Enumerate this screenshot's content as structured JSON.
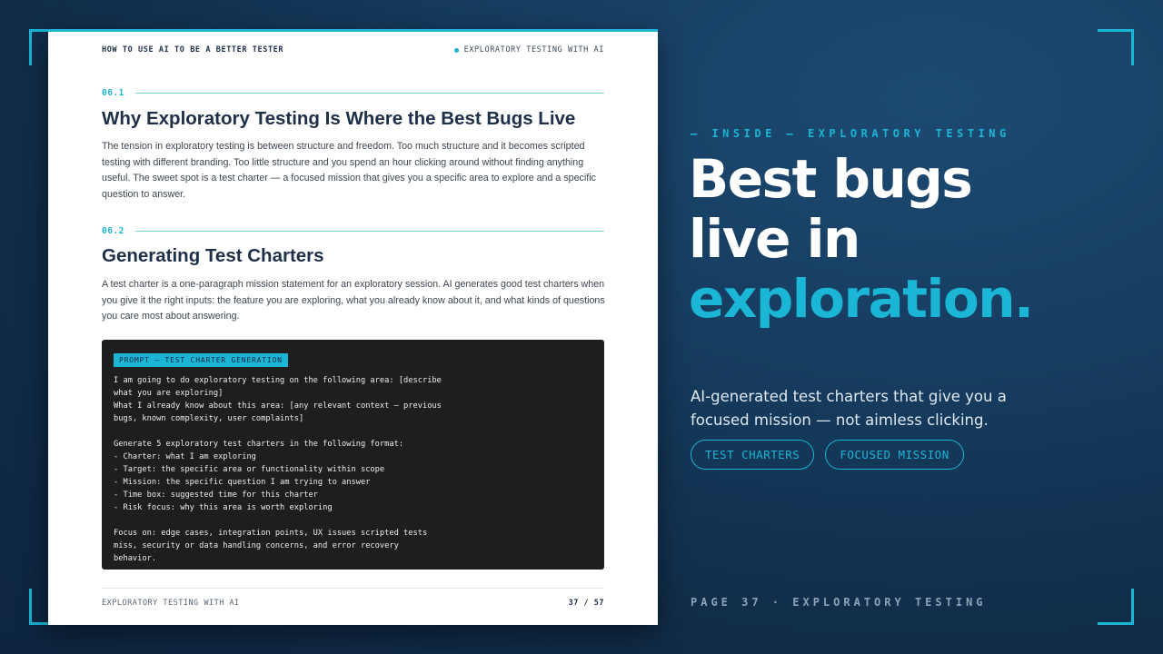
{
  "document": {
    "book_title": "HOW TO USE AI TO BE A BETTER TESTER",
    "chapter_label": "EXPLORATORY TESTING WITH AI",
    "sections": [
      {
        "number": "06.1",
        "title": "Why Exploratory Testing Is Where the Best Bugs Live",
        "body": "The tension in exploratory testing is between structure and freedom. Too much structure and it becomes scripted testing with different branding. Too little structure and you spend an hour clicking around without finding anything useful. The sweet spot is a test charter — a focused mission that gives you a specific area to explore and a specific question to answer."
      },
      {
        "number": "06.2",
        "title": "Generating Test Charters",
        "body": "A test charter is a one-paragraph mission statement for an exploratory session. AI generates good test charters when you give it the right inputs: the feature you are exploring, what you already know about it, and what kinds of questions you care most about answering."
      }
    ],
    "prompt_box": {
      "label": "PROMPT — TEST CHARTER GENERATION",
      "text": "I am going to do exploratory testing on the following area: [describe\nwhat you are exploring]\nWhat I already know about this area: [any relevant context — previous\nbugs, known complexity, user complaints]\n\nGenerate 5 exploratory test charters in the following format:\n- Charter: what I am exploring\n- Target: the specific area or functionality within scope\n- Mission: the specific question I am trying to answer\n- Time box: suggested time for this charter\n- Risk focus: why this area is worth exploring\n\nFocus on: edge cases, integration points, UX issues scripted tests\nmiss, security or data handling concerns, and error recovery\nbehavior."
    },
    "footer_left": "EXPLORATORY TESTING WITH AI",
    "footer_page": "37 / 57"
  },
  "promo": {
    "kicker": "— INSIDE — EXPLORATORY TESTING",
    "headline_line1": "Best bugs",
    "headline_line2": "live in",
    "headline_accent": "exploration.",
    "subtitle": "AI-generated test charters that give you a focused mission — not aimless clicking.",
    "pills": [
      "TEST CHARTERS",
      "FOCUSED MISSION"
    ],
    "page_label": "PAGE 37 · EXPLORATORY TESTING"
  },
  "colors": {
    "accent": "#1bb5d6",
    "background": "#163c5f",
    "heading": "#1e2f48",
    "code_bg": "#1e1e1e"
  }
}
